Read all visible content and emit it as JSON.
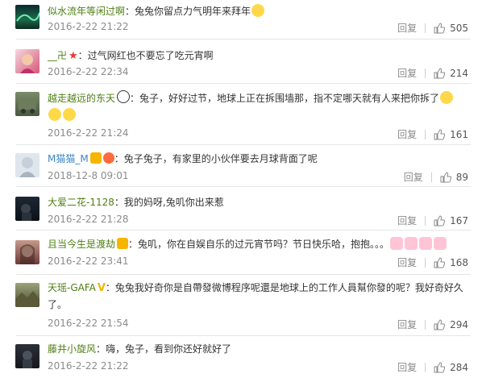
{
  "comments": [
    {
      "name": "似水流年等闲过啊",
      "name_color": "green",
      "text": "：兔兔你留点力气明年来拜年",
      "emoji": "sweat",
      "time": "2016-2-22 21:22",
      "reply": "回复",
      "likes": "505"
    },
    {
      "name": "__卍",
      "name_color": "green",
      "text": "：过气网红也不要忘了吃元宵啊",
      "emoji": "",
      "time": "2016-2-22 22:34",
      "reply": "回复",
      "likes": "214"
    },
    {
      "name": "越走越远的东天",
      "name_color": "green",
      "text": "：兔子，好好过节，地球上正在拆围墙那，指不定哪天就有人来把你拆了",
      "emoji": "laugh",
      "time": "2016-2-22 21:24",
      "reply": "回复",
      "likes": "161"
    },
    {
      "name": "M猫猫_M",
      "name_color": "green",
      "text": "：兔子兔子，有家里的小伙伴要去月球背面了呢",
      "emoji": "",
      "time": "2018-12-8 09:01",
      "reply": "回复",
      "likes": "89"
    },
    {
      "name": "大爱二花-1128",
      "name_color": "green",
      "text": "：我的妈呀,兔叽你出来惹",
      "emoji": "",
      "time": "2016-2-22 21:28",
      "reply": "回复",
      "likes": "167"
    },
    {
      "name": "且当今生是渡劫",
      "name_color": "green",
      "text": "：兔叽，你在自娱自乐的过元宵节吗？节日快乐哈，抱抱。。。",
      "emoji": "pig",
      "time": "2016-2-22 23:41",
      "reply": "回复",
      "likes": "168"
    },
    {
      "name": "天瑶-GAFA",
      "name_color": "green",
      "text": "：兔兔我好奇你是自帶發微博程序呢還是地球上的工作人員幫你發的呢？我好奇好久了。",
      "emoji": "",
      "time": "2016-2-22 21:54",
      "reply": "回复",
      "likes": "294"
    },
    {
      "name": "藤井小旋风",
      "name_color": "green",
      "text": "：嗨，兔子，看到你还好就好了",
      "emoji": "",
      "time": "2016-2-22 21:22",
      "reply": "回复",
      "likes": "284"
    }
  ]
}
